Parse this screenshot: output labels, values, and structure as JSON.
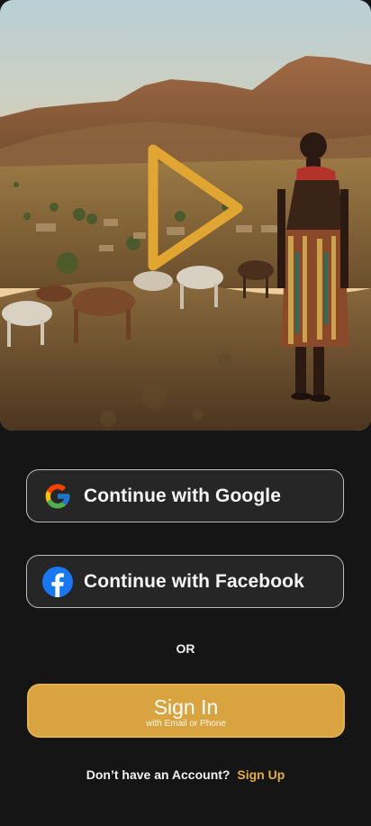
{
  "hero": {
    "description": "",
    "play_icon": "play-icon"
  },
  "auth": {
    "google": {
      "label": "Continue with Google",
      "icon": "google-icon"
    },
    "facebook": {
      "label": "Continue with Facebook",
      "icon": "facebook-icon"
    },
    "divider": "OR",
    "signin": {
      "label": "Sign In",
      "sublabel": "with Email or Phone"
    }
  },
  "footer": {
    "question": "Don’t have an Account?",
    "link": "Sign Up"
  },
  "colors": {
    "background": "#151515",
    "accent": "#d9a440",
    "button_bg": "#262626",
    "link": "#e4ad46"
  }
}
